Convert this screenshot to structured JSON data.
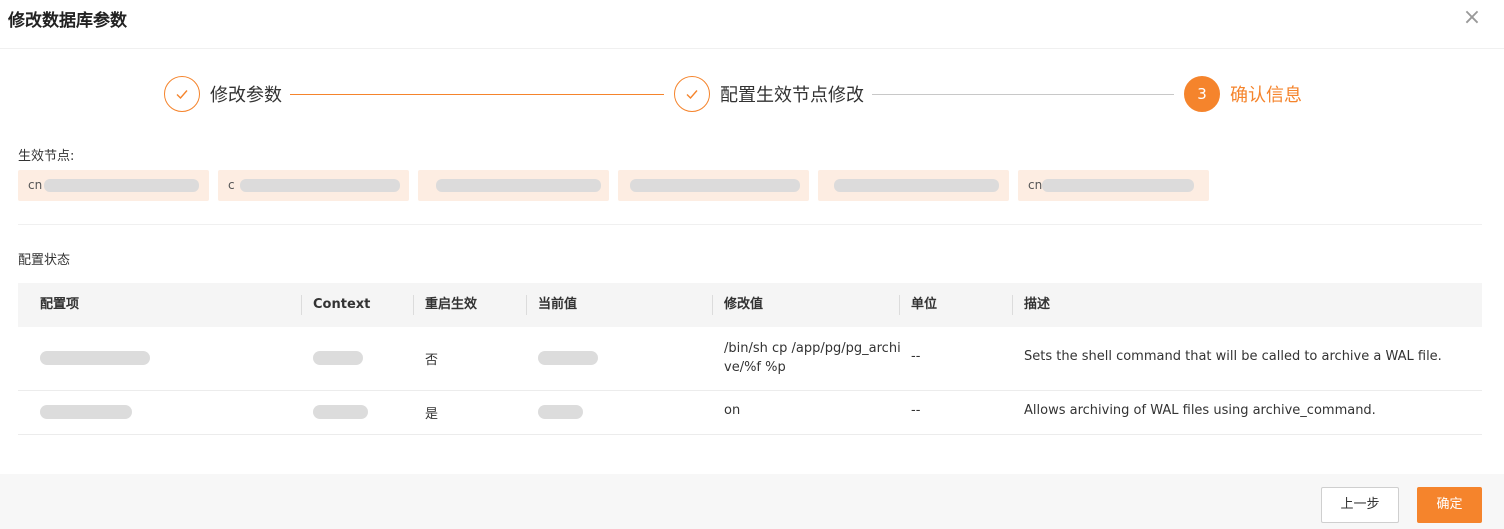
{
  "dialog": {
    "title": "修改数据库参数",
    "close_icon": "close-icon"
  },
  "steps": [
    {
      "label": "修改参数",
      "status": "done",
      "icon": "check-icon"
    },
    {
      "label": "配置生效节点修改",
      "status": "done",
      "icon": "check-icon"
    },
    {
      "label": "确认信息",
      "status": "active",
      "number": "3"
    }
  ],
  "effective_nodes": {
    "label": "生效节点:",
    "chips": [
      {
        "visible_text": "cn"
      },
      {
        "visible_text": "c"
      },
      {
        "visible_text": ""
      },
      {
        "visible_text": ""
      },
      {
        "visible_text": ""
      },
      {
        "visible_text": "cn"
      }
    ]
  },
  "config_status": {
    "label": "配置状态",
    "columns": [
      "配置项",
      "Context",
      "重启生效",
      "当前值",
      "修改值",
      "单位",
      "描述"
    ],
    "rows": [
      {
        "restart": "否",
        "new_value": "/bin/sh cp /app/pg/pg_archive/%f %p",
        "new_value_line1": "/bin/sh cp /app/pg/pg_archi",
        "new_value_line2": "ve/%f %p",
        "unit": "--",
        "description": "Sets the shell command that will be called to archive a WAL file."
      },
      {
        "restart": "是",
        "new_value": "on",
        "unit": "--",
        "description": "Allows archiving of WAL files using archive_command."
      }
    ]
  },
  "footer": {
    "prev_label": "上一步",
    "confirm_label": "确定"
  },
  "colors": {
    "accent": "#f5842c",
    "chip_bg": "#fdede2"
  }
}
